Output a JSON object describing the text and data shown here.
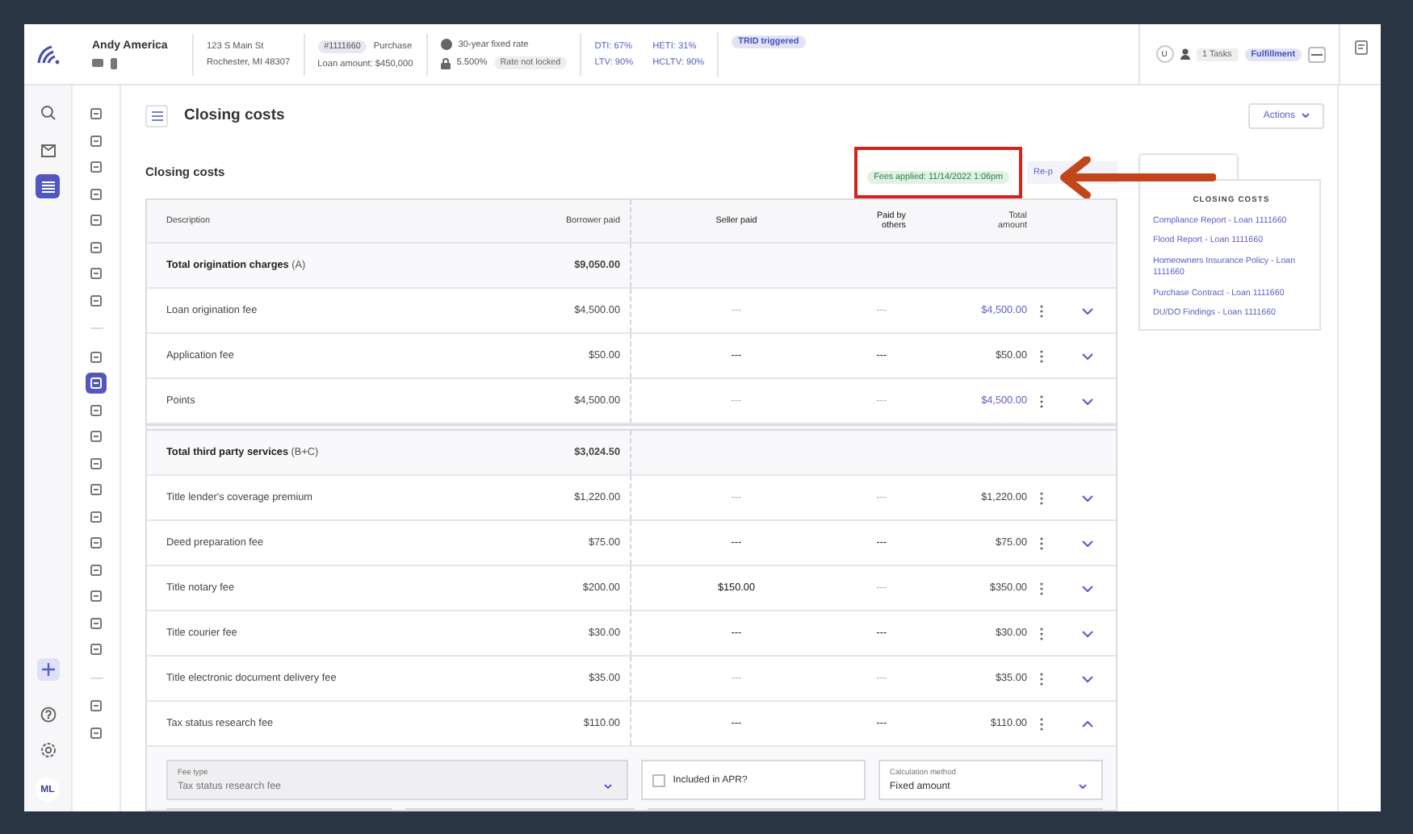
{
  "header": {
    "borrower": "Andy America",
    "address_line1": "123 S Main St",
    "address_line2": "Rochester, MI 48307",
    "loan_number": "#1111660",
    "loan_purpose": "Purchase",
    "loan_amount": "Loan amount: $450,000",
    "product": "30-year fixed rate",
    "rate": "5.500%",
    "lock_status": "Rate not locked",
    "ratios": [
      {
        "label": "DTI: 67%"
      },
      {
        "label": "HETI: 31%"
      },
      {
        "label": "LTV: 90%"
      },
      {
        "label": "HCLTV: 90%"
      }
    ],
    "trid_badge": "TRID triggered",
    "avatar": "U",
    "tasks": "1 Tasks",
    "stage": "Fulfillment"
  },
  "nav_rail": [
    {
      "selected": false
    },
    {
      "selected": false
    },
    {
      "selected": true
    }
  ],
  "rail_bottom": {
    "avatar": "ML"
  },
  "sub_nav_groups": [
    [
      {
        "selected": false
      },
      {
        "selected": false
      },
      {
        "selected": false
      },
      {
        "selected": false
      },
      {
        "selected": false
      },
      {
        "selected": false
      },
      {
        "selected": false
      },
      {
        "selected": false
      }
    ],
    [
      {
        "selected": false
      },
      {
        "selected": true
      },
      {
        "selected": false
      },
      {
        "selected": false
      },
      {
        "selected": false
      },
      {
        "selected": false
      },
      {
        "selected": false
      },
      {
        "selected": false
      },
      {
        "selected": false
      },
      {
        "selected": false
      },
      {
        "selected": false
      },
      {
        "selected": false
      }
    ],
    [
      {
        "selected": false
      },
      {
        "selected": false
      }
    ]
  ],
  "page": {
    "title": "Closing costs",
    "actions": "Actions"
  },
  "section": {
    "title": "Closing costs",
    "fees_applied": "Fees applied: 11/14/2022 1:06pm",
    "reapply": "Re-p"
  },
  "table": {
    "columns": [
      "Description",
      "Borrower paid",
      "Seller paid",
      "Paid by others",
      "Total amount"
    ],
    "rows": [
      {
        "kind": "total",
        "description": "Total origination charges",
        "suffix": "(A)",
        "borrower": "$9,050.00"
      },
      {
        "kind": "fee",
        "description": "Loan origination fee",
        "borrower": "$4,500.00",
        "seller": "---",
        "others": "---",
        "total": "$4,500.00",
        "dashes_muted": true,
        "linked": true,
        "expanded": false
      },
      {
        "kind": "fee",
        "description": "Application fee",
        "borrower": "$50.00",
        "seller": "---",
        "others": "---",
        "total": "$50.00",
        "dashes_muted": false,
        "linked": false,
        "expanded": false
      },
      {
        "kind": "fee",
        "description": "Points",
        "borrower": "$4,500.00",
        "seller": "---",
        "others": "---",
        "total": "$4,500.00",
        "dashes_muted": true,
        "linked": true,
        "expanded": false
      },
      {
        "kind": "total",
        "description": "Total third party services",
        "suffix": "(B+C)",
        "borrower": "$3,024.50"
      },
      {
        "kind": "fee",
        "description": "Title lender's coverage premium",
        "borrower": "$1,220.00",
        "seller": "---",
        "others": "---",
        "total": "$1,220.00",
        "dashes_muted": true,
        "linked": false,
        "expanded": false
      },
      {
        "kind": "fee",
        "description": "Deed preparation fee",
        "borrower": "$75.00",
        "seller": "---",
        "others": "---",
        "total": "$75.00",
        "dashes_muted": false,
        "linked": false,
        "expanded": false
      },
      {
        "kind": "fee",
        "description": "Title notary fee",
        "borrower": "$200.00",
        "seller": "$150.00",
        "others": "---",
        "total": "$350.00",
        "dashes_muted": true,
        "seller_plain": true,
        "linked": false,
        "expanded": false
      },
      {
        "kind": "fee",
        "description": "Title courier fee",
        "borrower": "$30.00",
        "seller": "---",
        "others": "---",
        "total": "$30.00",
        "dashes_muted": false,
        "linked": false,
        "expanded": false
      },
      {
        "kind": "fee",
        "description": "Title electronic document delivery fee",
        "borrower": "$35.00",
        "seller": "---",
        "others": "---",
        "total": "$35.00",
        "dashes_muted": true,
        "linked": false,
        "expanded": false
      },
      {
        "kind": "fee",
        "description": "Tax status research fee",
        "borrower": "$110.00",
        "seller": "---",
        "others": "---",
        "total": "$110.00",
        "dashes_muted": false,
        "linked": false,
        "expanded": true
      }
    ]
  },
  "fee_detail": {
    "fee_type_label": "Fee type",
    "fee_type": "Tax status research fee",
    "fee_type_disabled": true,
    "apr_label": "Included in APR?",
    "apr_checked": false,
    "calc_label": "Calculation method",
    "calc_value": "Fixed amount"
  },
  "docs_panel": {
    "heading": "CLOSING COSTS",
    "links": [
      "Compliance Report - Loan 1111660",
      "Flood Report - Loan 1111660",
      "Homeowners Insurance Policy - Loan 1111660",
      "Purchase Contract - Loan 1111660",
      "DU/DO Findings - Loan 1111660"
    ]
  }
}
